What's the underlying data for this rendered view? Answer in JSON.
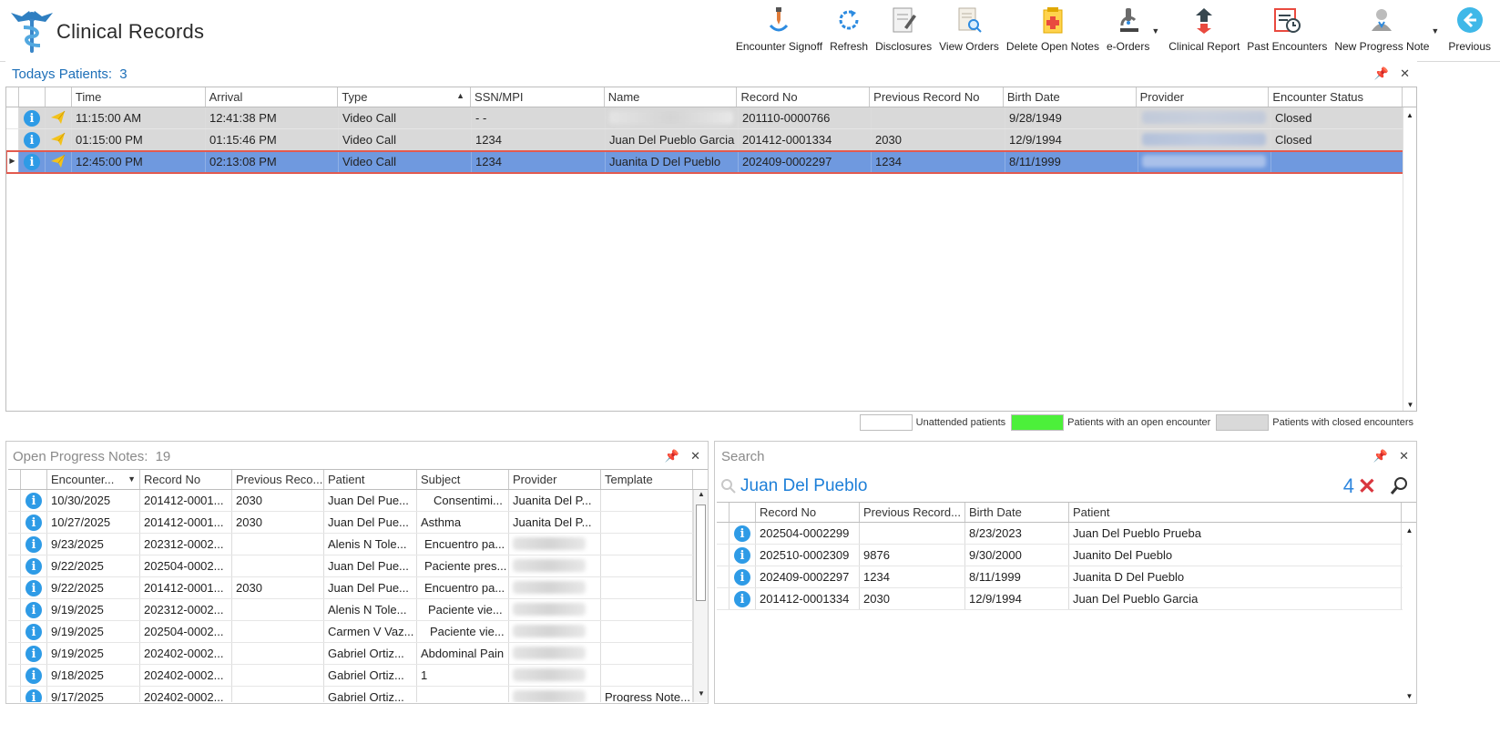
{
  "app": {
    "title": "Clinical Records",
    "logo_icon": "caduceus-logo-icon"
  },
  "toolbar": [
    {
      "label": "Encounter Signoff",
      "icon": "pen-signoff-icon"
    },
    {
      "label": "Refresh",
      "icon": "refresh-icon"
    },
    {
      "label": "Disclosures",
      "icon": "disclosure-doc-icon"
    },
    {
      "label": "View Orders",
      "icon": "view-orders-icon"
    },
    {
      "label": "Delete Open Notes",
      "icon": "delete-notes-icon"
    },
    {
      "label": "e-Orders",
      "icon": "microscope-icon"
    },
    {
      "label": "Clinical Report",
      "icon": "clinical-report-icon"
    },
    {
      "label": "Past Encounters",
      "icon": "past-encounters-icon"
    },
    {
      "label": "New Progress Note",
      "icon": "new-progress-note-icon"
    },
    {
      "label": "Previous",
      "icon": "back-arrow-icon"
    }
  ],
  "today": {
    "title": "Todays Patients:",
    "count": "3",
    "columns": [
      "Time",
      "Arrival",
      "Type",
      "SSN/MPI",
      "Name",
      "Record No",
      "Previous Record No",
      "Birth Date",
      "Provider",
      "Encounter Status"
    ],
    "rows": [
      {
        "time": "11:15:00 AM",
        "arrival": "12:41:38 PM",
        "type": "Video Call",
        "ssn": "- -",
        "name": "",
        "record": "201110-0000766",
        "prev": "",
        "birth": "9/28/1949",
        "provider": "",
        "status": "Closed",
        "state": "closed"
      },
      {
        "time": "01:15:00 PM",
        "arrival": "01:15:46 PM",
        "type": "Video Call",
        "ssn": "1234",
        "name": "Juan Del Pueblo Garcia",
        "record": "201412-0001334",
        "prev": "2030",
        "birth": "12/9/1994",
        "provider": "",
        "status": "Closed",
        "state": "closed"
      },
      {
        "time": "12:45:00 PM",
        "arrival": "02:13:08 PM",
        "type": "Video Call",
        "ssn": "1234",
        "name": "Juanita D Del Pueblo",
        "record": "202409-0002297",
        "prev": "1234",
        "birth": "8/11/1999",
        "provider": "",
        "status": "",
        "state": "selected"
      }
    ],
    "legend": [
      {
        "label": "Unattended patients",
        "color": "#ffffff"
      },
      {
        "label": "Patients with an open encounter",
        "color": "#4cf03a"
      },
      {
        "label": "Patients with closed encounters",
        "color": "#d9d9d9"
      }
    ]
  },
  "notes": {
    "title": "Open Progress Notes:",
    "count": "19",
    "columns": [
      "Encounter...",
      "Record No",
      "Previous Reco...",
      "Patient",
      "Subject",
      "Provider",
      "Template"
    ],
    "rows": [
      {
        "date": "10/30/2025",
        "record": "201412-0001...",
        "prev": "2030",
        "patient": "Juan Del Pue...",
        "subject": "Consentimi...",
        "provider": "Juanita Del P...",
        "template": ""
      },
      {
        "date": "10/27/2025",
        "record": "201412-0001...",
        "prev": "2030",
        "patient": "Juan Del Pue...",
        "subject": "Asthma",
        "provider": "Juanita Del P...",
        "template": ""
      },
      {
        "date": "9/23/2025",
        "record": "202312-0002...",
        "prev": "",
        "patient": "Alenis N Tole...",
        "subject": "Encuentro pa...",
        "provider": "",
        "template": ""
      },
      {
        "date": "9/22/2025",
        "record": "202504-0002...",
        "prev": "",
        "patient": "Juan Del Pue...",
        "subject": "Paciente pres...",
        "provider": "",
        "template": ""
      },
      {
        "date": "9/22/2025",
        "record": "201412-0001...",
        "prev": "2030",
        "patient": "Juan Del Pue...",
        "subject": "Encuentro pa...",
        "provider": "",
        "template": ""
      },
      {
        "date": "9/19/2025",
        "record": "202312-0002...",
        "prev": "",
        "patient": "Alenis N Tole...",
        "subject": "Paciente vie...",
        "provider": "",
        "template": ""
      },
      {
        "date": "9/19/2025",
        "record": "202504-0002...",
        "prev": "",
        "patient": "Carmen V Vaz...",
        "subject": "Paciente vie...",
        "provider": "",
        "template": ""
      },
      {
        "date": "9/19/2025",
        "record": "202402-0002...",
        "prev": "",
        "patient": "Gabriel Ortiz...",
        "subject": "Abdominal Pain",
        "provider": "",
        "template": ""
      },
      {
        "date": "9/18/2025",
        "record": "202402-0002...",
        "prev": "",
        "patient": "Gabriel Ortiz...",
        "subject": "1",
        "provider": "",
        "template": ""
      },
      {
        "date": "9/17/2025",
        "record": "202402-0002...",
        "prev": "",
        "patient": "Gabriel Ortiz...",
        "subject": "",
        "provider": "",
        "template": "Progress Note..."
      }
    ]
  },
  "search": {
    "title": "Search",
    "term": "Juan Del Pueblo",
    "result_count": "4",
    "columns": [
      "Record No",
      "Previous Record...",
      "Birth Date",
      "Patient"
    ],
    "rows": [
      {
        "record": "202504-0002299",
        "prev": "",
        "birth": "8/23/2023",
        "patient": "Juan Del Pueblo Prueba"
      },
      {
        "record": "202510-0002309",
        "prev": "9876",
        "birth": "9/30/2000",
        "patient": "Juanito Del Pueblo"
      },
      {
        "record": "202409-0002297",
        "prev": "1234",
        "birth": "8/11/1999",
        "patient": "Juanita D Del Pueblo"
      },
      {
        "record": "201412-0001334",
        "prev": "2030",
        "birth": "12/9/1994",
        "patient": "Juan Del Pueblo Garcia"
      }
    ]
  }
}
